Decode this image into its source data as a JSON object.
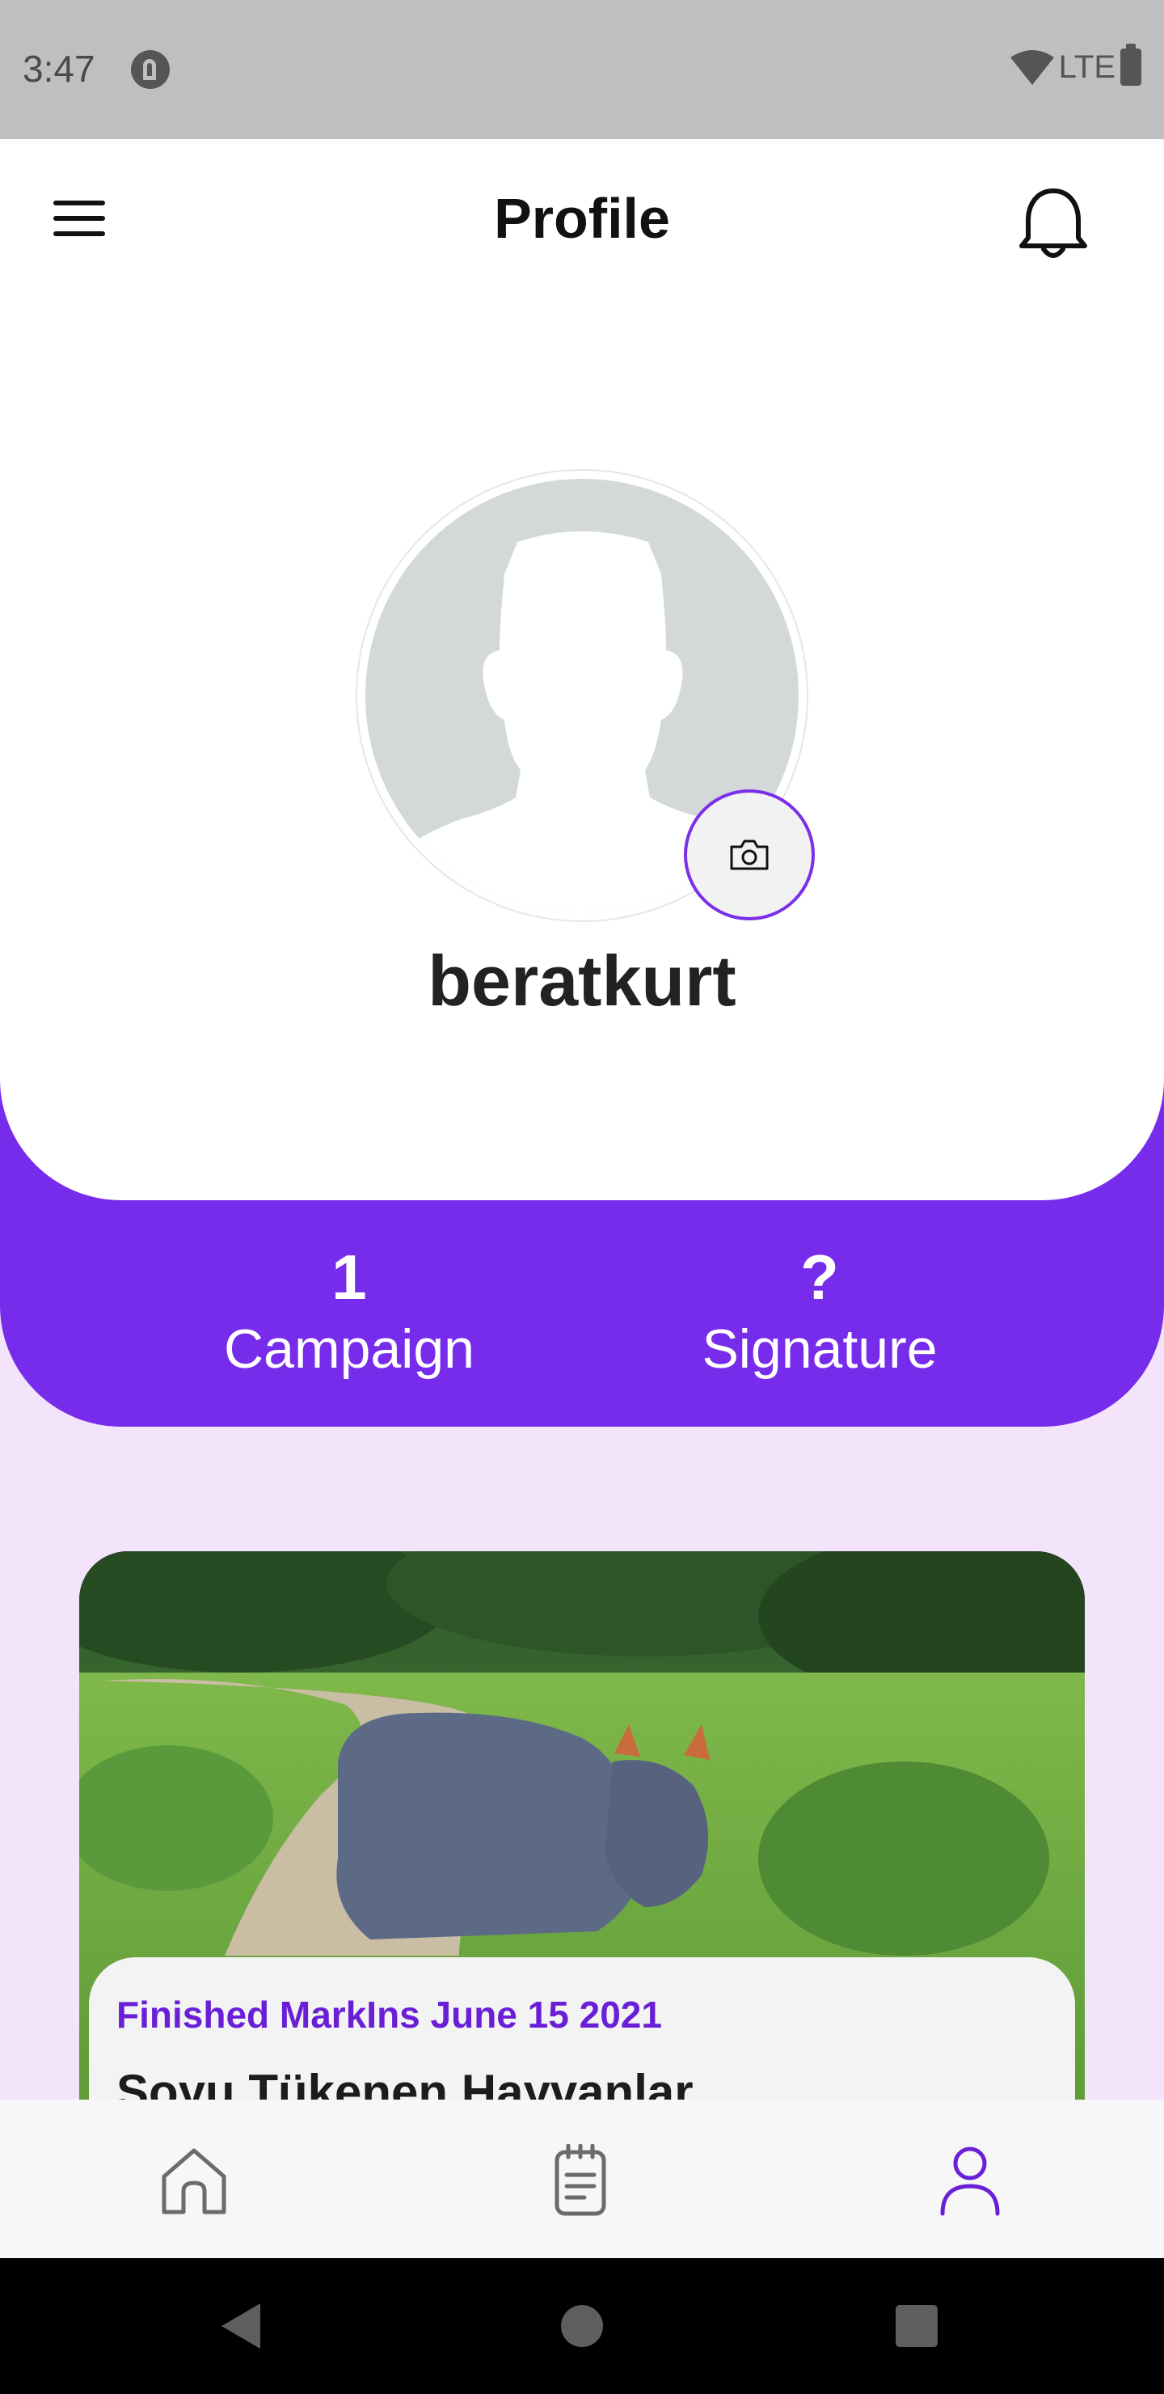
{
  "status_bar": {
    "time": "3:47",
    "network": "LTE"
  },
  "header": {
    "title": "Profile",
    "menu_icon": "hamburger-menu-icon",
    "bell_icon": "bell-icon"
  },
  "profile": {
    "username": "beratkurt",
    "avatar_icon": "person-silhouette-icon",
    "camera_icon": "camera-icon"
  },
  "stats": [
    {
      "value": "1",
      "label": "Campaign"
    },
    {
      "value": "?",
      "label": "Signature"
    }
  ],
  "campaign": {
    "status": "Finished MarkIns June 15 2021",
    "title": "Soyu Tükenen Hayvanlar",
    "image": "rhinoceros-on-dirt-road-photo"
  },
  "bottom_nav": [
    {
      "icon": "home-icon",
      "active": false
    },
    {
      "icon": "notepad-icon",
      "active": false
    },
    {
      "icon": "profile-icon",
      "active": true
    }
  ],
  "colors": {
    "accent": "#782ceb",
    "background": "#f3e4fb",
    "status_text": "#6a1fd6"
  }
}
